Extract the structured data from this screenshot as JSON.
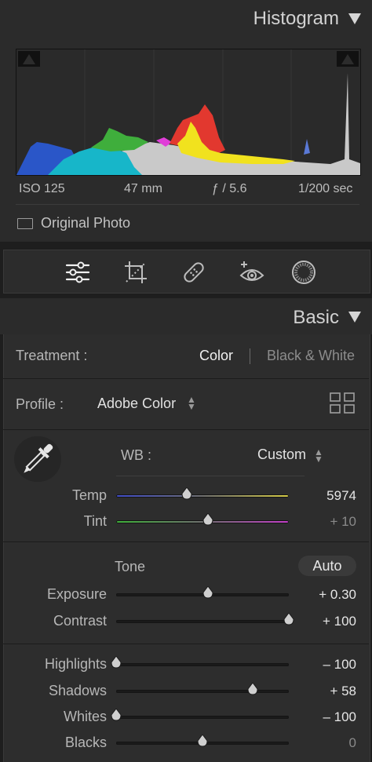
{
  "histogram": {
    "title": "Histogram",
    "exif": {
      "iso": "ISO 125",
      "focal": "47 mm",
      "aperture": "ƒ / 5.6",
      "shutter": "1/200 sec"
    },
    "original_photo_label": "Original Photo"
  },
  "tools": [
    "edit-sliders-icon",
    "crop-icon",
    "healing-icon",
    "red-eye-icon",
    "mask-icon"
  ],
  "basic": {
    "title": "Basic",
    "treatment_label": "Treatment :",
    "treatment_color": "Color",
    "treatment_bw": "Black & White",
    "profile_label": "Profile :",
    "profile_value": "Adobe Color",
    "wb_label": "WB :",
    "wb_value": "Custom",
    "tone_label": "Tone",
    "auto_label": "Auto",
    "sliders": [
      {
        "label": "Temp",
        "value": "5974",
        "fraction": 0.41,
        "dim": false
      },
      {
        "label": "Tint",
        "value": "+ 10",
        "fraction": 0.53,
        "dim": true
      },
      {
        "label": "Exposure",
        "value": "+ 0.30",
        "fraction": 0.53,
        "dim": false
      },
      {
        "label": "Contrast",
        "value": "+ 100",
        "fraction": 1.0,
        "dim": false
      },
      {
        "label": "Highlights",
        "value": "– 100",
        "fraction": 0.0,
        "dim": false
      },
      {
        "label": "Shadows",
        "value": "+ 58",
        "fraction": 0.79,
        "dim": false
      },
      {
        "label": "Whites",
        "value": "– 100",
        "fraction": 0.0,
        "dim": false
      },
      {
        "label": "Blacks",
        "value": "0",
        "fraction": 0.5,
        "dim": true
      }
    ]
  },
  "colors": {
    "accent_text": "#e6e6e6",
    "panel_bg": "#2d2d2d"
  }
}
